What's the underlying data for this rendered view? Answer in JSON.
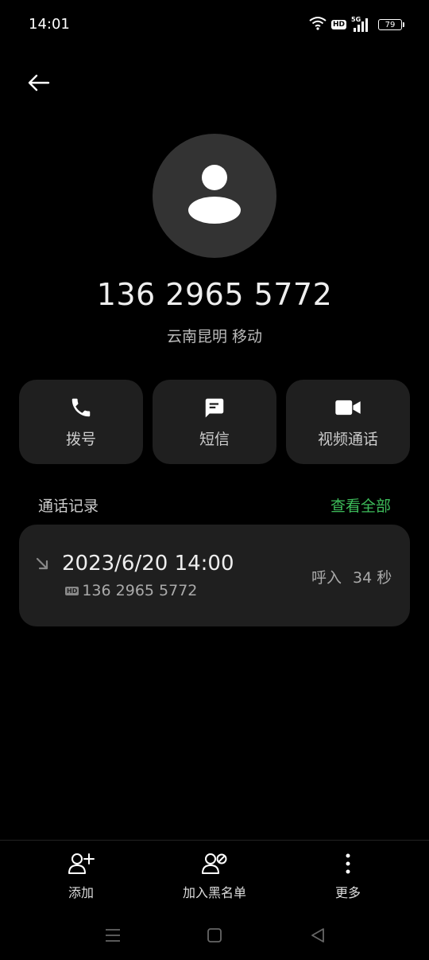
{
  "status_bar": {
    "time": "14:01",
    "hd": "HD",
    "network": "5G",
    "battery": "79"
  },
  "contact": {
    "phone": "136 2965 5772",
    "location": "云南昆明 移动"
  },
  "actions": {
    "call": "拨号",
    "sms": "短信",
    "video": "视频通话"
  },
  "history": {
    "title": "通话记录",
    "view_all": "查看全部",
    "entry": {
      "datetime": "2023/6/20 14:00",
      "hd": "HD",
      "number": "136 2965 5772",
      "type": "呼入",
      "duration": "34 秒"
    }
  },
  "bottom": {
    "add": "添加",
    "blacklist": "加入黑名单",
    "more": "更多"
  },
  "colors": {
    "accent_green": "#3dbb5a",
    "card_bg": "#1f1f1f"
  }
}
